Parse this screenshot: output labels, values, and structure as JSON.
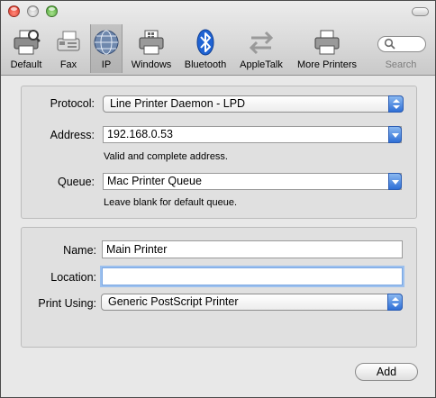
{
  "toolbar": {
    "items": [
      {
        "label": "Default",
        "icon": "printer-icon"
      },
      {
        "label": "Fax",
        "icon": "fax-icon"
      },
      {
        "label": "IP",
        "icon": "globe-icon"
      },
      {
        "label": "Windows",
        "icon": "windows-printer-icon"
      },
      {
        "label": "Bluetooth",
        "icon": "bluetooth-icon"
      },
      {
        "label": "AppleTalk",
        "icon": "appletalk-arrows-icon"
      },
      {
        "label": "More Printers",
        "icon": "printer-icon"
      }
    ],
    "selected": "IP",
    "search_label": "Search"
  },
  "connection": {
    "protocol_label": "Protocol:",
    "protocol_value": "Line Printer Daemon - LPD",
    "address_label": "Address:",
    "address_value": "192.168.0.53",
    "address_hint": "Valid and complete address.",
    "queue_label": "Queue:",
    "queue_value": "Mac Printer Queue",
    "queue_hint": "Leave blank for default queue."
  },
  "printer": {
    "name_label": "Name:",
    "name_value": "Main Printer",
    "location_label": "Location:",
    "location_value": "",
    "print_using_label": "Print Using:",
    "print_using_value": "Generic PostScript Printer"
  },
  "actions": {
    "add_label": "Add"
  },
  "colors": {
    "accent": "#2f6fd6",
    "focus_ring": "#9cc0ee"
  }
}
